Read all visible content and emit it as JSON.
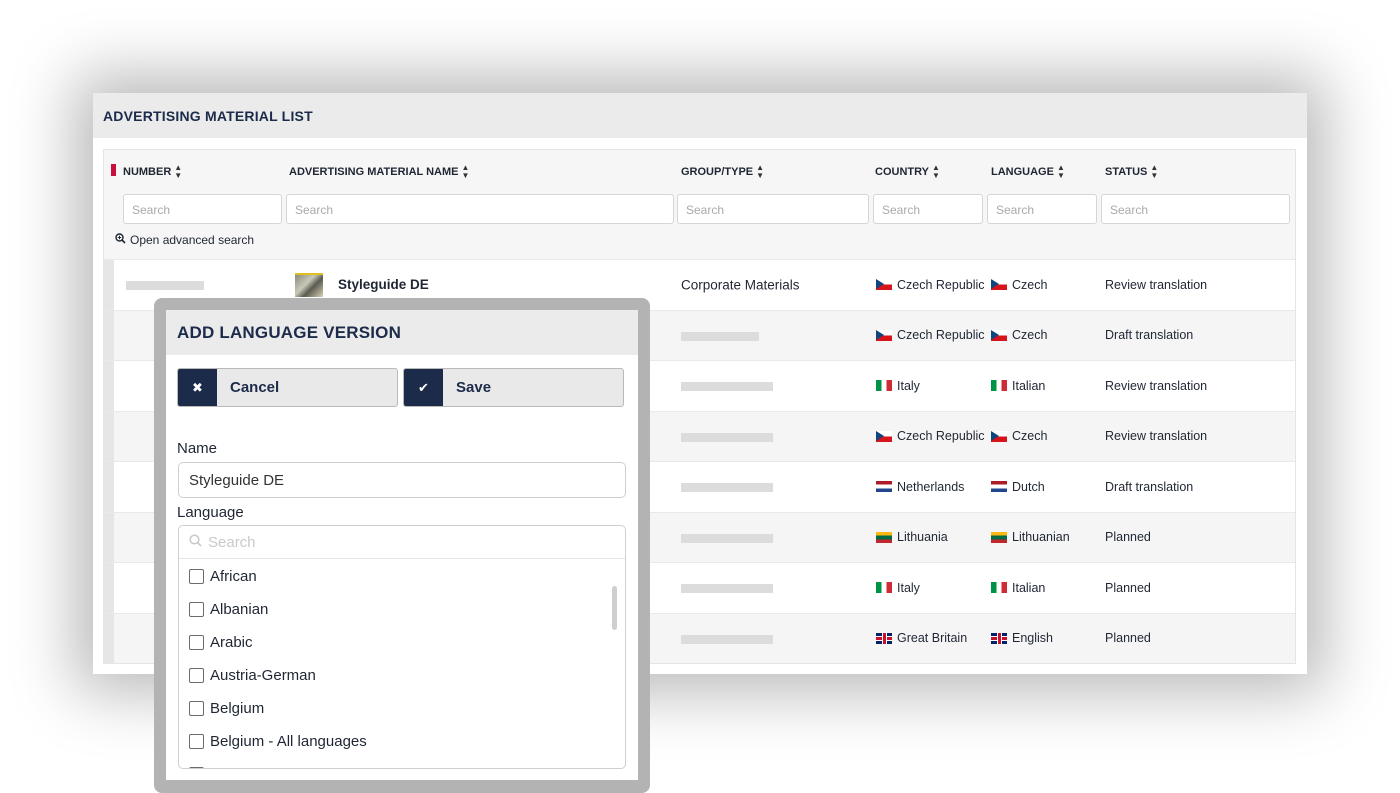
{
  "panel": {
    "title": "ADVERTISING MATERIAL LIST"
  },
  "table": {
    "columns": [
      {
        "label": "NUMBER",
        "sort_icon": "sort-icon"
      },
      {
        "label": "ADVERTISING MATERIAL NAME",
        "sort_icon": "sort-icon"
      },
      {
        "label": "GROUP/TYPE",
        "sort_icon": "sort-icon"
      },
      {
        "label": "COUNTRY",
        "sort_icon": "sort-icon"
      },
      {
        "label": "LANGUAGE",
        "sort_icon": "sort-icon"
      },
      {
        "label": "STATUS",
        "sort_icon": "sort-icon"
      }
    ],
    "search_placeholder": "Search",
    "advanced_search_label": "Open advanced search",
    "rows": [
      {
        "name": "Styleguide DE",
        "group": "Corporate Materials",
        "country": "Czech Republic",
        "country_flag": "cz",
        "language": "Czech",
        "language_flag": "cz",
        "status": "Review translation"
      },
      {
        "name": "",
        "group": "",
        "country": "Czech Republic",
        "country_flag": "cz",
        "language": "Czech",
        "language_flag": "cz",
        "status": "Draft translation"
      },
      {
        "name": "",
        "group": "",
        "country": "Italy",
        "country_flag": "it",
        "language": "Italian",
        "language_flag": "it",
        "status": "Review translation"
      },
      {
        "name": "",
        "group": "",
        "country": "Czech Republic",
        "country_flag": "cz",
        "language": "Czech",
        "language_flag": "cz",
        "status": "Review translation"
      },
      {
        "name": "",
        "group": "",
        "country": "Netherlands",
        "country_flag": "nl",
        "language": "Dutch",
        "language_flag": "nl",
        "status": "Draft translation"
      },
      {
        "name": "",
        "group": "",
        "country": "Lithuania",
        "country_flag": "lt",
        "language": "Lithuanian",
        "language_flag": "lt",
        "status": "Planned"
      },
      {
        "name": "",
        "group": "",
        "country": "Italy",
        "country_flag": "it",
        "language": "Italian",
        "language_flag": "it",
        "status": "Planned"
      },
      {
        "name": "",
        "group": "",
        "country": "Great Britain",
        "country_flag": "gb",
        "language": "English",
        "language_flag": "gb",
        "status": "Planned"
      }
    ]
  },
  "modal": {
    "title": "ADD LANGUAGE VERSION",
    "cancel_label": "Cancel",
    "cancel_icon": "close-icon",
    "save_label": "Save",
    "save_icon": "check-icon",
    "name_label": "Name",
    "name_value": "Styleguide DE",
    "language_label": "Language",
    "language_search_placeholder": "Search",
    "languages": [
      "African",
      "Albanian",
      "Arabic",
      "Austria-German",
      "Belgium",
      "Belgium - All languages"
    ]
  },
  "colors": {
    "accent": "#1c2b4a",
    "marker": "#c8103e"
  }
}
